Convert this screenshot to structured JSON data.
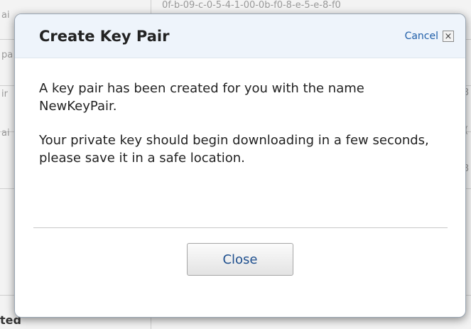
{
  "background": {
    "fragments": [
      "ai",
      "pa",
      "ir",
      "ai",
      "0f-b-09-c-0-5-4-1-00-0b-f0-8-e-5-e-8-f0",
      "3",
      "(",
      "3"
    ],
    "bottom_text": "ted"
  },
  "dialog": {
    "title": "Create Key Pair",
    "cancel_label": "Cancel",
    "close_glyph": "×",
    "message_1": "A key pair has been created for you with the name NewKeyPair.",
    "message_2": "Your private key should begin downloading in a few seconds, please save it in a safe location.",
    "close_button_label": "Close"
  },
  "colors": {
    "header_bg": "#eef4fb",
    "link": "#1f5ea8",
    "button_text": "#1e4f8e"
  }
}
